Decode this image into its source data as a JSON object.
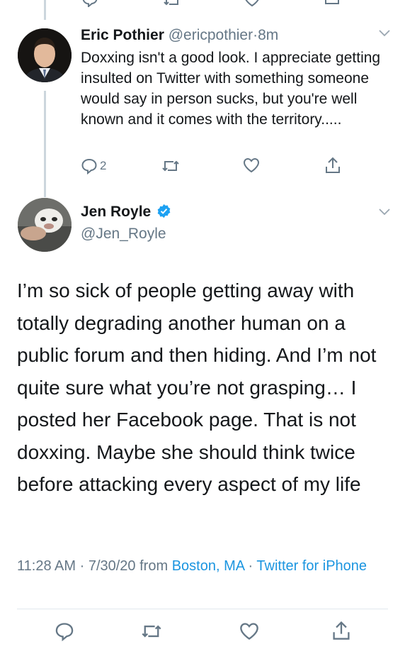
{
  "prev_tweet": {
    "icons": [
      "reply-icon",
      "retweet-icon",
      "like-icon",
      "share-icon"
    ]
  },
  "reply_tweet": {
    "display_name": "Eric Pothier",
    "handle": "@ericpothier",
    "separator": "·",
    "time": "8m",
    "text": "Doxxing isn't a good look. I appreciate getting insulted on Twitter with something someone would say in person sucks, but you're well known and it comes with the territory.....",
    "reply_count": "2"
  },
  "main_tweet": {
    "display_name": "Jen Royle",
    "handle": "@Jen_Royle",
    "verified": true,
    "text": "I’m so sick of people getting away with totally degrading another human on a public forum and then hiding. And I’m not quite sure what you’re not grasping… I posted her Facebook page. That is not doxxing. Maybe she should think twice before attacking every aspect of my life",
    "time": "11:28 AM",
    "date_sep": "·",
    "date": "7/30/20",
    "from_label": "from",
    "location": "Boston, MA",
    "source_sep": "·",
    "source": "Twitter for iPhone"
  },
  "colors": {
    "accent": "#1b95e0",
    "secondary_text": "#657786",
    "border": "#e1e8ed",
    "verified": "#1da1f2"
  }
}
